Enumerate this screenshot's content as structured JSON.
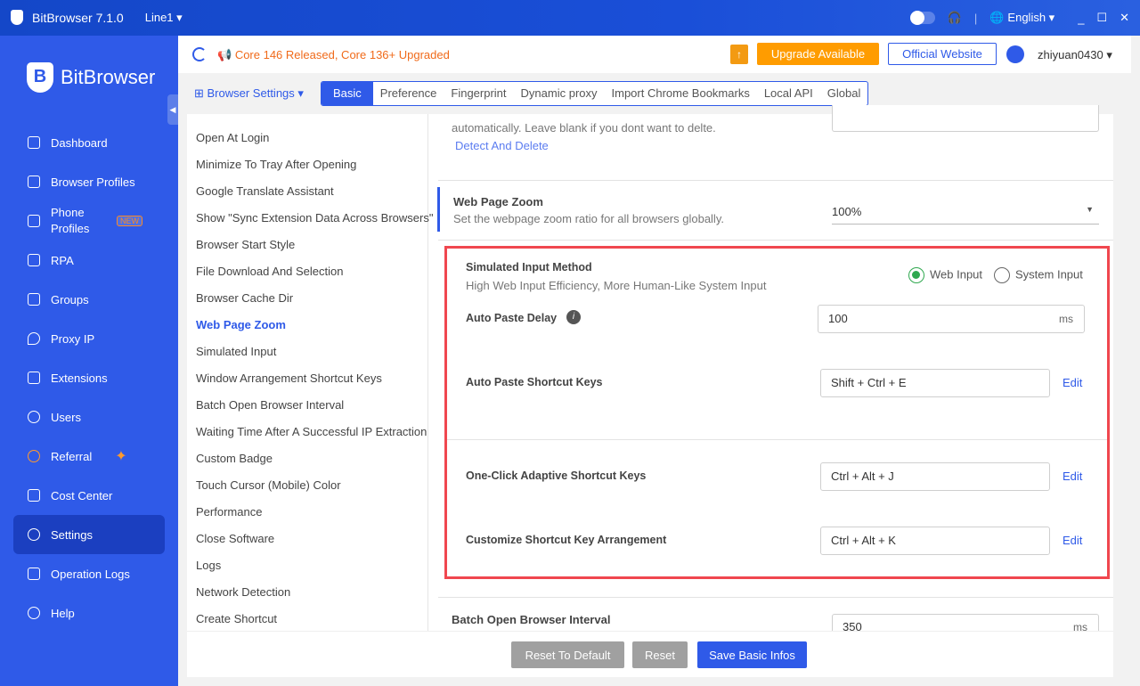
{
  "titlebar": {
    "app": "BitBrowser 7.1.0",
    "line": "Line1 ▾",
    "language": "English ▾"
  },
  "brand": "BitBrowser",
  "sidebar": {
    "items": [
      {
        "label": "Dashboard"
      },
      {
        "label": "Browser Profiles"
      },
      {
        "label": "Phone Profiles",
        "badge": "NEW"
      },
      {
        "label": "RPA"
      },
      {
        "label": "Groups"
      },
      {
        "label": "Proxy IP"
      },
      {
        "label": "Extensions"
      },
      {
        "label": "Users"
      },
      {
        "label": "Referral"
      },
      {
        "label": "Cost Center"
      },
      {
        "label": "Settings"
      },
      {
        "label": "Operation Logs"
      },
      {
        "label": "Help"
      }
    ]
  },
  "header": {
    "notice": "Core 146 Released, Core 136+ Upgraded",
    "upgrade": "Upgrade Available",
    "official": "Official Website",
    "user": "zhiyuan0430 ▾"
  },
  "settings_menu": "Browser Settings ▾",
  "tabs": [
    "Basic",
    "Preference",
    "Fingerprint",
    "Dynamic proxy",
    "Import Chrome Bookmarks",
    "Local API",
    "Global"
  ],
  "left_list": [
    "Open At Login",
    "Minimize To Tray After Opening",
    "Google Translate Assistant",
    "Show \"Sync Extension Data Across Browsers\"",
    "Browser Start Style",
    "File Download And Selection",
    "Browser Cache Dir",
    "Web Page Zoom",
    "Simulated Input",
    "Window Arrangement Shortcut Keys",
    "Batch Open Browser Interval",
    "Waiting Time After A Successful IP Extraction",
    "Custom Badge",
    "Touch Cursor (Mobile) Color",
    "Performance",
    "Close Software",
    "Logs",
    "Network Detection",
    "Create Shortcut"
  ],
  "content": {
    "prev_desc": "automatically. Leave blank if you dont want to delte.",
    "detect": "Detect And Delete",
    "zoom_title": "Web Page Zoom",
    "zoom_desc": "Set the webpage zoom ratio for all browsers globally.",
    "zoom_value": "100%",
    "sim_title": "Simulated Input Method",
    "sim_desc": "High Web Input Efficiency, More Human-Like System Input",
    "web_input": "Web Input",
    "system_input": "System Input",
    "delay_title": "Auto Paste Delay",
    "delay_value": "100",
    "delay_unit": "ms",
    "paste_title": "Auto Paste Shortcut Keys",
    "paste_value": "Shift + Ctrl + E",
    "adaptive_title": "One-Click Adaptive Shortcut Keys",
    "adaptive_value": "Ctrl + Alt + J",
    "arrange_title": "Customize Shortcut Key Arrangement",
    "arrange_value": "Ctrl + Alt + K",
    "edit": "Edit",
    "batch_title": "Batch Open Browser Interval",
    "batch_value": "350",
    "batch_unit": "ms"
  },
  "footer": {
    "reset_default": "Reset To Default",
    "reset": "Reset",
    "save": "Save Basic Infos"
  }
}
